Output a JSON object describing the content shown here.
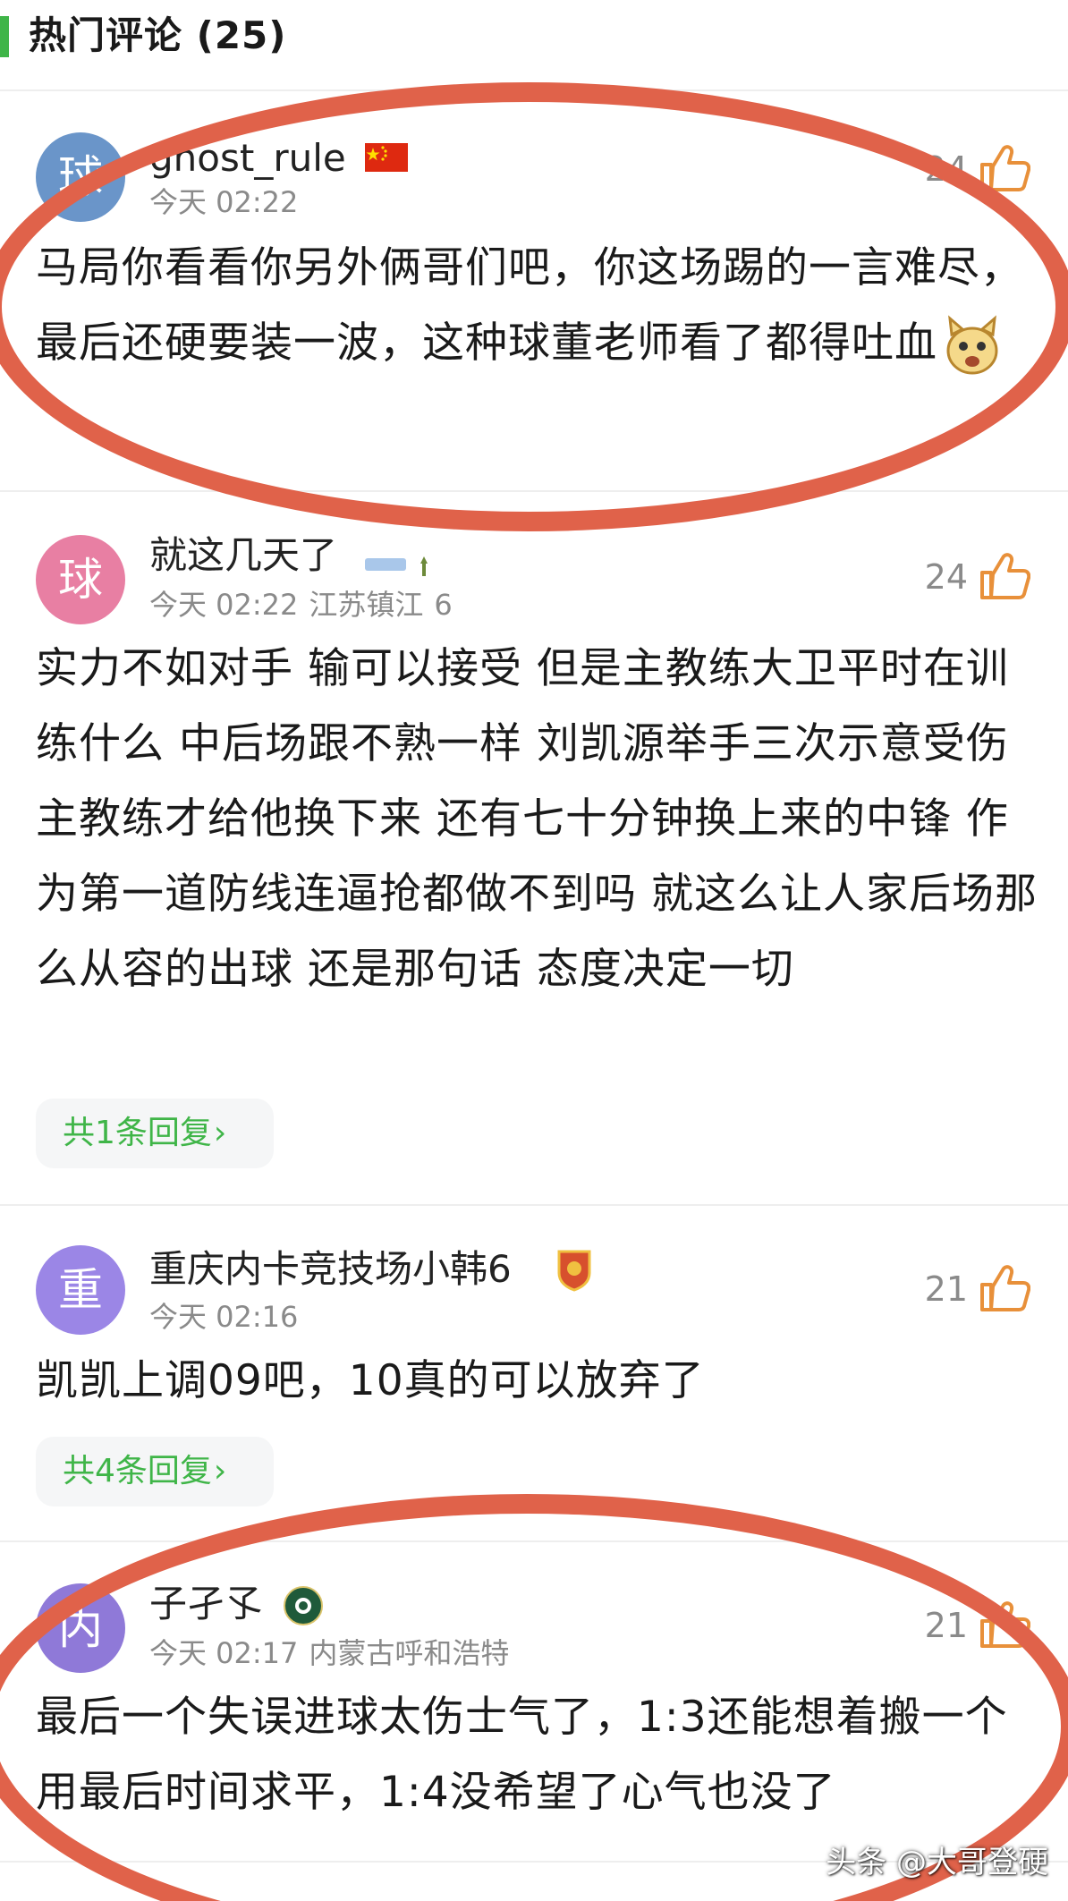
{
  "header": {
    "title": "热门评论 (25)"
  },
  "comments": [
    {
      "avatar_char": "球",
      "avatar_color": "#6a95c9",
      "username": "ghost_rule",
      "badge": "china-flag-icon",
      "time": "今天 02:22",
      "location": "",
      "likes": "24",
      "text": "马局你看看你另外俩哥们吧，你这场踢的一言难尽，最后还硬要装一波，这种球董老师看了都得吐血",
      "emoji": "squirrel-emoji-icon",
      "replies": ""
    },
    {
      "avatar_char": "球",
      "avatar_color": "#e87fa3",
      "username": "就这几天了",
      "badge": "fan-badge-icon",
      "time": "今天 02:22",
      "location": "江苏镇江",
      "extra": "6",
      "likes": "24",
      "text": "实力不如对手 输可以接受 但是主教练大卫平时在训练什么 中后场跟不熟一样 刘凯源举手三次示意受伤 主教练才给他换下来 还有七十分钟换上来的中锋 作为第一道防线连逼抢都做不到吗 就这么让人家后场那么从容的出球 还是那句话 态度决定一切",
      "replies": "共1条回复"
    },
    {
      "avatar_char": "重",
      "avatar_color": "#9b86e6",
      "username": "重庆内卡竞技场小韩6",
      "badge": "club-shield-icon",
      "time": "今天 02:16",
      "location": "",
      "likes": "21",
      "text": "凯凯上调09吧，10真的可以放弃了",
      "replies": "共4条回复"
    },
    {
      "avatar_char": "内",
      "avatar_color": "#8f79d8",
      "username": "子孑孓",
      "badge": "club-round-icon",
      "time": "今天 02:17",
      "location": "内蒙古呼和浩特",
      "likes": "21",
      "text": "最后一个失误进球太伤士气了，1:3还能想着搬一个用最后时间求平，1:4没希望了心气也没了",
      "replies": ""
    }
  ],
  "watermark": "头条 @大哥登硬",
  "colors": {
    "accent": "#3fb548",
    "annotation": "#e0624a",
    "like": "#e8903a"
  }
}
